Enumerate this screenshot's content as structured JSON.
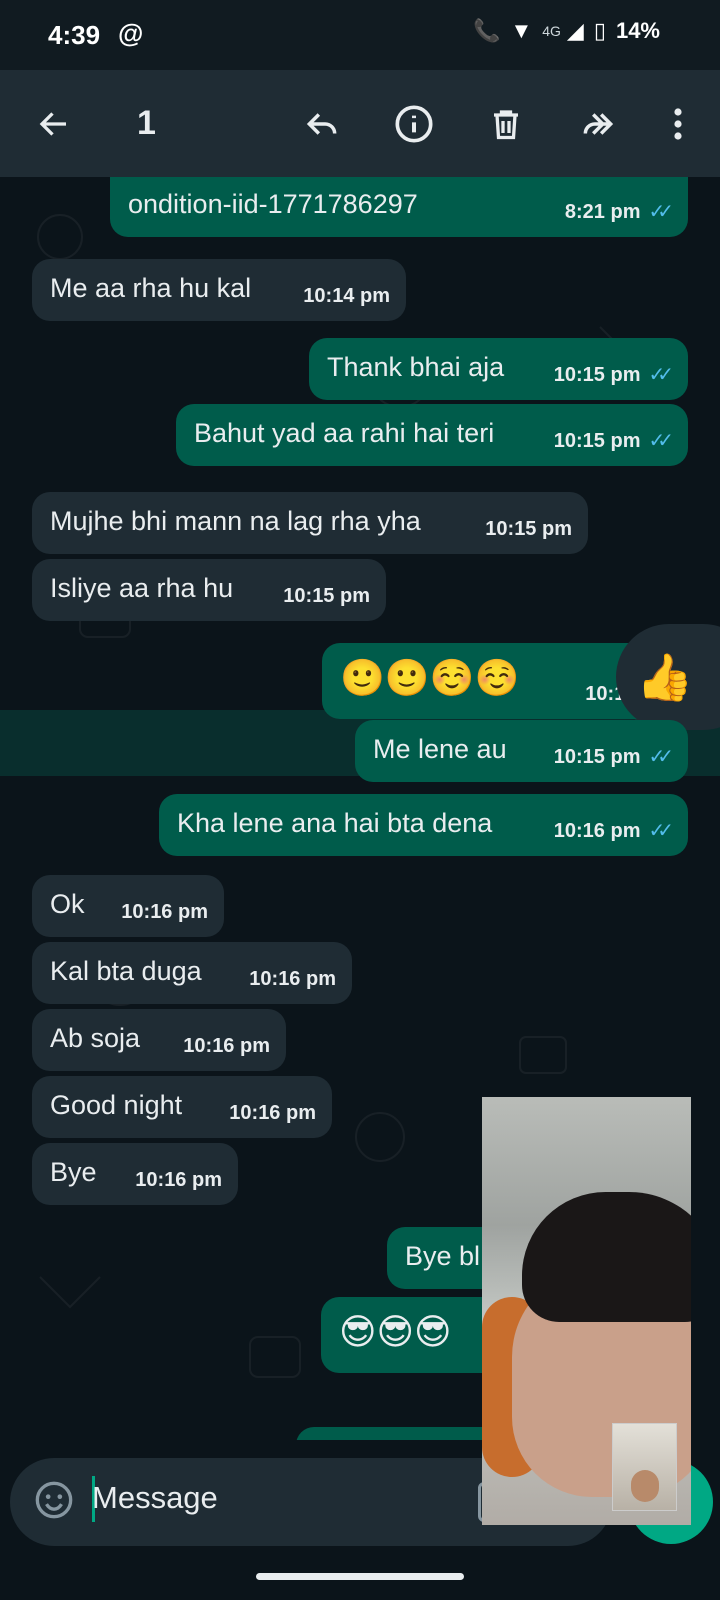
{
  "status_bar": {
    "time": "4:39",
    "network": "4G",
    "battery": "14%"
  },
  "app_bar": {
    "selected_count": "1"
  },
  "chat": {
    "messages": [
      {
        "dir": "out",
        "text": "ondition-iid-1771786297",
        "time": "8:21 pm",
        "ticks": "✓✓"
      },
      {
        "dir": "in",
        "text": "Me aa rha hu kal",
        "time": "10:14 pm"
      },
      {
        "dir": "out",
        "text": "Thank bhai aja",
        "time": "10:15 pm",
        "ticks": "✓✓"
      },
      {
        "dir": "out",
        "text": "Bahut yad aa rahi hai teri",
        "time": "10:15 pm",
        "ticks": "✓✓"
      },
      {
        "dir": "in",
        "text": "Mujhe bhi mann na lag rha yha",
        "time": "10:15 pm"
      },
      {
        "dir": "in",
        "text": "Isliye aa rha hu",
        "time": "10:15 pm"
      },
      {
        "dir": "out",
        "text": "🙂🙂☺️☺️",
        "time": "10:15 pm",
        "ticks": ""
      },
      {
        "dir": "out",
        "text": "Me lene au",
        "time": "10:15 pm",
        "ticks": "✓✓",
        "selected": true
      },
      {
        "dir": "out",
        "text": "Kha lene ana hai bta dena",
        "time": "10:16 pm",
        "ticks": "✓✓"
      },
      {
        "dir": "in",
        "text": "Ok",
        "time": "10:16 pm"
      },
      {
        "dir": "in",
        "text": "Kal bta duga",
        "time": "10:16 pm"
      },
      {
        "dir": "in",
        "text": "Ab soja",
        "time": "10:16 pm"
      },
      {
        "dir": "in",
        "text": "Good night",
        "time": "10:16 pm"
      },
      {
        "dir": "in",
        "text": "Bye",
        "time": "10:16 pm"
      },
      {
        "dir": "out",
        "text": "Bye bl",
        "time": ""
      },
      {
        "dir": "out",
        "text": "😎😎😎",
        "time": ""
      }
    ],
    "reaction": "👍"
  },
  "input": {
    "placeholder": "Message"
  },
  "colors": {
    "incoming": "#1f2c34",
    "outgoing": "#005c4b",
    "accent": "#00a884",
    "tick": "#53bdeb"
  },
  "icons": [
    "back-arrow-icon",
    "reply-icon",
    "info-icon",
    "delete-icon",
    "forward-icon",
    "more-vert-icon",
    "emoji-icon",
    "attach-icon",
    "mic-icon",
    "thumbs-up-icon"
  ]
}
